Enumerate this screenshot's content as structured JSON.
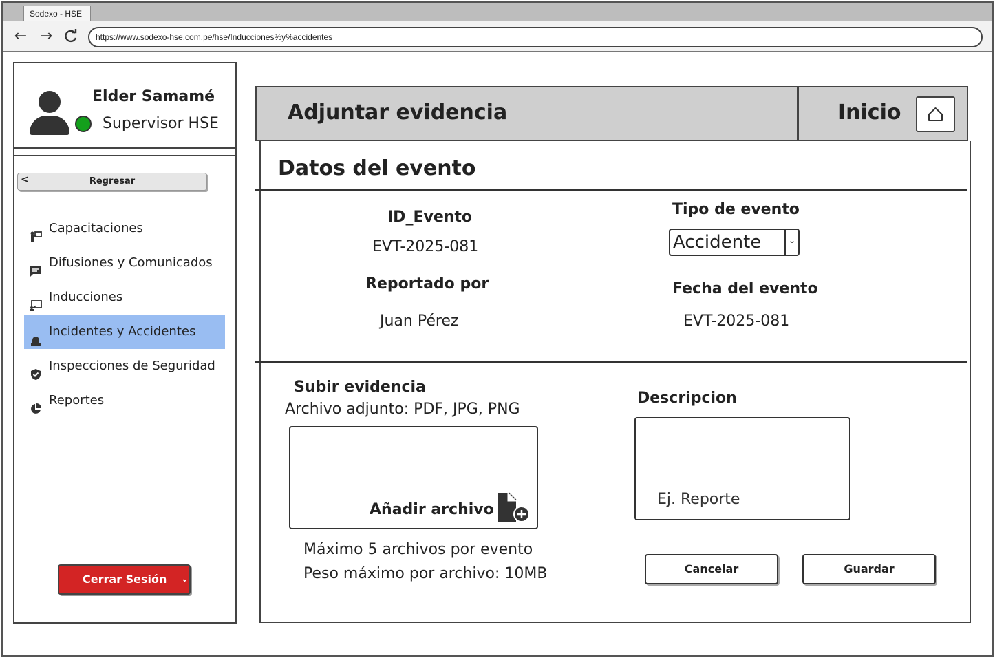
{
  "browser": {
    "tab_title": "Sodexo - HSE",
    "url": "https://www.sodexo-hse.com.pe/hse/Inducciones%y%accidentes",
    "back_icon": "←",
    "forward_icon": "→",
    "reload_icon": "C"
  },
  "user": {
    "name": "Elder Samamé",
    "role": "Supervisor HSE",
    "status_color": "#14a01c"
  },
  "sidebar": {
    "back_label": "Regresar",
    "back_chevron": "<",
    "items": [
      {
        "label": "Capacitaciones",
        "icon": "trainer-icon"
      },
      {
        "label": "Difusiones y Comunicados",
        "icon": "message-icon"
      },
      {
        "label": "Inducciones",
        "icon": "presentation-icon"
      },
      {
        "label": "Incidentes y Accidentes",
        "icon": "alarm-icon",
        "active": true
      },
      {
        "label": "Inspecciones de Seguridad",
        "icon": "shield-check-icon"
      },
      {
        "label": "Reportes",
        "icon": "pie-chart-icon"
      }
    ],
    "active_color": "#99bdf2",
    "logout_label": "Cerrar Sesión",
    "logout_chevron": "⌄",
    "logout_color": "#d32424"
  },
  "header": {
    "title": "Adjuntar evidencia",
    "home_label": "Inicio",
    "home_icon": "home-icon"
  },
  "event": {
    "section_title": "Datos del evento",
    "id_label": "ID_Evento",
    "id_value": "EVT-2025-081",
    "type_label": "Tipo de evento",
    "type_value": "Accidente",
    "type_chevron": "⌄",
    "reported_label": "Reportado por",
    "reported_value": "Juan Pérez",
    "date_label": "Fecha del evento",
    "date_value": "EVT-2025-081"
  },
  "upload": {
    "title": "Subir evidencia",
    "formats": "Archivo adjunto: PDF, JPG, PNG",
    "add_label": "Añadir archivo",
    "add_icon": "file-add-icon",
    "limit_files": "Máximo 5 archivos por evento",
    "limit_size": "Peso máximo por archivo: 10MB"
  },
  "description": {
    "label": "Descripcion",
    "placeholder": "Ej. Reporte"
  },
  "actions": {
    "cancel": "Cancelar",
    "save": "Guardar"
  }
}
